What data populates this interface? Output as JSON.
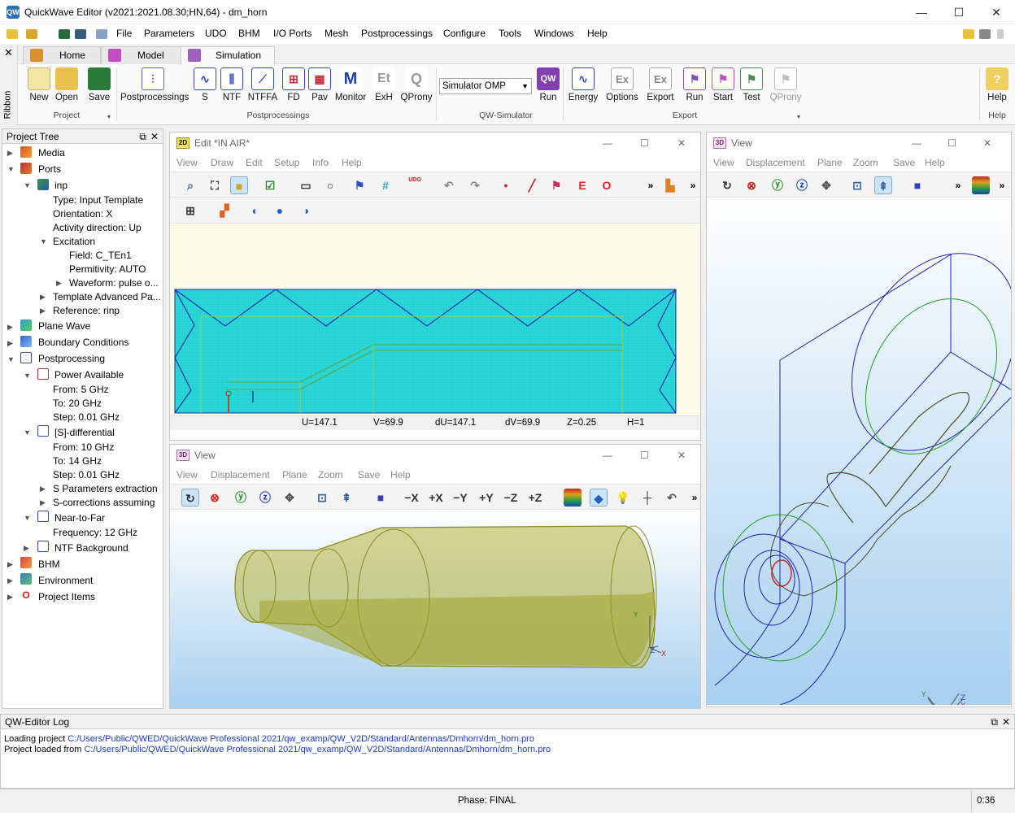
{
  "window": {
    "title": "QuickWave Editor (v2021:2021.08.30;HN,64) - dm_horn",
    "minimize": "—",
    "maximize": "☐",
    "close": "✕"
  },
  "menu": [
    "File",
    "Parameters",
    "UDO",
    "BHM",
    "I/O Ports",
    "Mesh",
    "Postprocessings",
    "Configure",
    "Tools",
    "Windows",
    "Help"
  ],
  "ribbon": {
    "side_label": "Ribbon",
    "tabs": [
      "Home",
      "Model",
      "Simulation"
    ],
    "active_tab": "Simulation",
    "project": {
      "group": "Project",
      "buttons": [
        "New",
        "Open",
        "Save"
      ]
    },
    "postprocessings": {
      "group": "Postprocessings",
      "buttons": [
        "Postprocessings",
        "S",
        "NTF",
        "NTFFA",
        "FD",
        "Pav",
        "Monitor",
        "ExH",
        "QProny"
      ]
    },
    "simulator": {
      "group": "QW-Simulator",
      "select_value": "Simulator OMP",
      "run": "Run"
    },
    "export": {
      "group": "Export",
      "buttons": [
        "Energy",
        "Options",
        "Export",
        "Run",
        "Start",
        "Test",
        "QProny"
      ]
    },
    "help": {
      "group": "Help",
      "button": "Help"
    }
  },
  "project_tree": {
    "title": "Project Tree",
    "items": {
      "media": "Media",
      "ports": "Ports",
      "inp": "inp",
      "type": "Type: Input Template",
      "orientation": "Orientation: X",
      "activity": "Activity direction: Up",
      "excitation": "Excitation",
      "field": "Field: C_TEn1",
      "permittivity": "Permitivity: AUTO",
      "waveform": "Waveform: pulse o...",
      "template_adv": "Template Advanced Pa...",
      "reference": "Reference: rinp",
      "plane_wave": "Plane Wave",
      "boundary": "Boundary Conditions",
      "postprocessing": "Postprocessing",
      "power": "Power Available",
      "p_from": "From: 5 GHz",
      "p_to": "To: 20 GHz",
      "p_step": "Step: 0.01 GHz",
      "s_diff": "[S]-differential",
      "s_from": "From: 10 GHz",
      "s_to": "To: 14 GHz",
      "s_step": "Step: 0.01 GHz",
      "s_extract": "S Parameters extraction",
      "s_corr": "S-corrections assuming",
      "n2f": "Near-to-Far",
      "freq": "Frequency: 12 GHz",
      "ntf_bg": "NTF Background",
      "bhm": "BHM",
      "environment": "Environment",
      "project_items": "Project Items"
    }
  },
  "edit_window": {
    "badge": "2D",
    "title": "Edit  *IN AIR*",
    "menu": [
      "View",
      "Draw",
      "Edit",
      "Setup",
      "Info",
      "Help"
    ],
    "status": {
      "u": "U=147.1",
      "v": "V=69.9",
      "du": "dU=147.1",
      "dv": "dV=69.9",
      "z": "Z=0.25",
      "h": "H=1"
    },
    "tool_letters": {
      "e": "E",
      "o": "O",
      "udo": "UDO"
    }
  },
  "view3d_bottom": {
    "badge": "3D",
    "title": "View",
    "menu": [
      "View",
      "Displacement",
      "Plane",
      "Zoom",
      "Save",
      "Help"
    ],
    "axis_buttons": [
      "−X",
      "+X",
      "−Y",
      "+Y",
      "−Z",
      "+Z"
    ]
  },
  "view3d_right": {
    "badge": "3D",
    "title": "View",
    "menu": [
      "View",
      "Displacement",
      "Plane",
      "Zoom",
      "Save",
      "Help"
    ]
  },
  "axes": {
    "x": "X",
    "y": "Y",
    "z": "Z"
  },
  "log": {
    "title": "QW-Editor Log",
    "lines": [
      {
        "prefix": "Loading project ",
        "path": "C:/Users/Public/QWED/QuickWave Professional 2021/qw_examp/QW_V2D/Standard/Antennas/Dmhorn/dm_horn.pro"
      },
      {
        "prefix": "Project loaded from ",
        "path": "C:/Users/Public/QWED/QuickWave Professional 2021/qw_examp/QW_V2D/Standard/Antennas/Dmhorn/dm_horn.pro"
      }
    ]
  },
  "statusbar": {
    "phase": "Phase: FINAL",
    "time": "0:36"
  },
  "colors": {
    "mesh": "#22d8d8",
    "horn": "#b4b43c",
    "sky_top": "#ffffff",
    "sky_bottom": "#a8d0f0"
  }
}
